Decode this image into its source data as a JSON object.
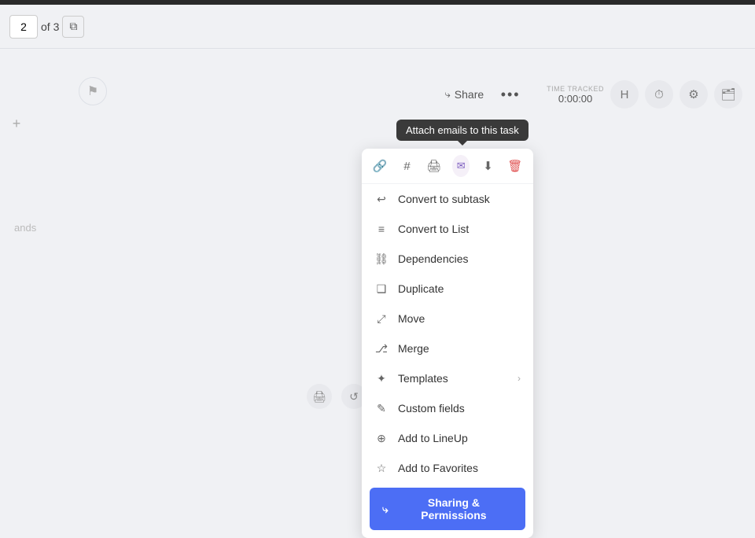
{
  "topbar": {
    "bg": "#2a2a2a"
  },
  "header": {
    "page_current": "2",
    "page_of": "of 3"
  },
  "toolbar": {
    "share_label": "Share",
    "more_dots": "•••",
    "time_tracked_label": "TIME TRACKED",
    "time_tracked_value": "0:00:00"
  },
  "sidebar": {
    "text": "ands"
  },
  "tooltip": {
    "text": "Attach emails to this task"
  },
  "dropdown": {
    "icon_bar": {
      "link_icon": "🔗",
      "hash_icon": "#",
      "print_icon": "⎙",
      "email_icon": "✉",
      "download_icon": "⬇",
      "delete_icon": "🗑"
    },
    "items": [
      {
        "id": "convert-subtask",
        "icon": "↩",
        "label": "Convert to subtask"
      },
      {
        "id": "convert-list",
        "icon": "≡",
        "label": "Convert to List"
      },
      {
        "id": "dependencies",
        "icon": "⛓",
        "label": "Dependencies"
      },
      {
        "id": "duplicate",
        "icon": "❑",
        "label": "Duplicate"
      },
      {
        "id": "move",
        "icon": "⤢",
        "label": "Move"
      },
      {
        "id": "merge",
        "icon": "⎇",
        "label": "Merge"
      },
      {
        "id": "templates",
        "icon": "✦",
        "label": "Templates",
        "has_chevron": true
      },
      {
        "id": "custom-fields",
        "icon": "✎",
        "label": "Custom fields"
      },
      {
        "id": "add-lineup",
        "icon": "⊕",
        "label": "Add to LineUp"
      },
      {
        "id": "add-favorites",
        "icon": "☆",
        "label": "Add to Favorites"
      }
    ],
    "sharing_button": "Sharing & Permissions"
  }
}
